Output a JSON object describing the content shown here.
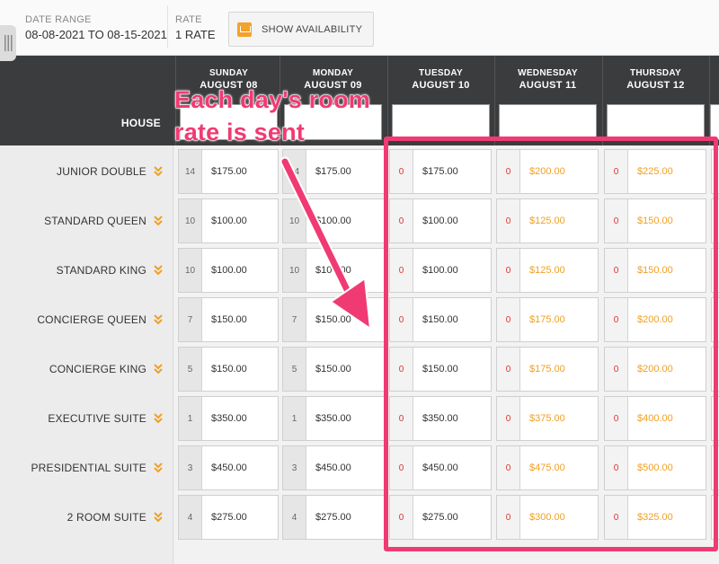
{
  "toolbar": {
    "date_range_label": "DATE RANGE",
    "date_range_value": "08-08-2021 TO 08-15-2021",
    "rate_label": "RATE",
    "rate_value": "1 RATE",
    "show_availability_label": "SHOW AVAILABILITY"
  },
  "grid": {
    "house_label": "HOUSE",
    "days": [
      {
        "name": "SUNDAY",
        "date": "AUGUST 08"
      },
      {
        "name": "MONDAY",
        "date": "AUGUST 09"
      },
      {
        "name": "TUESDAY",
        "date": "AUGUST 10"
      },
      {
        "name": "WEDNESDAY",
        "date": "AUGUST 11"
      },
      {
        "name": "THURSDAY",
        "date": "AUGUST 12"
      }
    ],
    "rooms": [
      {
        "name": "JUNIOR DOUBLE",
        "cells": [
          {
            "avail": "14",
            "price": "$175.00"
          },
          {
            "avail": "14",
            "price": "$175.00"
          },
          {
            "avail": "0",
            "price": "$175.00"
          },
          {
            "avail": "0",
            "price": "$200.00"
          },
          {
            "avail": "0",
            "price": "$225.00"
          }
        ]
      },
      {
        "name": "STANDARD QUEEN",
        "cells": [
          {
            "avail": "10",
            "price": "$100.00"
          },
          {
            "avail": "10",
            "price": "$100.00"
          },
          {
            "avail": "0",
            "price": "$100.00"
          },
          {
            "avail": "0",
            "price": "$125.00"
          },
          {
            "avail": "0",
            "price": "$150.00"
          }
        ]
      },
      {
        "name": "STANDARD KING",
        "cells": [
          {
            "avail": "10",
            "price": "$100.00"
          },
          {
            "avail": "10",
            "price": "$100.00"
          },
          {
            "avail": "0",
            "price": "$100.00"
          },
          {
            "avail": "0",
            "price": "$125.00"
          },
          {
            "avail": "0",
            "price": "$150.00"
          }
        ]
      },
      {
        "name": "CONCIERGE QUEEN",
        "cells": [
          {
            "avail": "7",
            "price": "$150.00"
          },
          {
            "avail": "7",
            "price": "$150.00"
          },
          {
            "avail": "0",
            "price": "$150.00"
          },
          {
            "avail": "0",
            "price": "$175.00"
          },
          {
            "avail": "0",
            "price": "$200.00"
          }
        ]
      },
      {
        "name": "CONCIERGE KING",
        "cells": [
          {
            "avail": "5",
            "price": "$150.00"
          },
          {
            "avail": "5",
            "price": "$150.00"
          },
          {
            "avail": "0",
            "price": "$150.00"
          },
          {
            "avail": "0",
            "price": "$175.00"
          },
          {
            "avail": "0",
            "price": "$200.00"
          }
        ]
      },
      {
        "name": "EXECUTIVE SUITE",
        "cells": [
          {
            "avail": "1",
            "price": "$350.00"
          },
          {
            "avail": "1",
            "price": "$350.00"
          },
          {
            "avail": "0",
            "price": "$350.00"
          },
          {
            "avail": "0",
            "price": "$375.00"
          },
          {
            "avail": "0",
            "price": "$400.00"
          }
        ]
      },
      {
        "name": "PRESIDENTIAL SUITE",
        "cells": [
          {
            "avail": "3",
            "price": "$450.00"
          },
          {
            "avail": "3",
            "price": "$450.00"
          },
          {
            "avail": "0",
            "price": "$450.00"
          },
          {
            "avail": "0",
            "price": "$475.00"
          },
          {
            "avail": "0",
            "price": "$500.00"
          }
        ]
      },
      {
        "name": "2 ROOM SUITE",
        "cells": [
          {
            "avail": "4",
            "price": "$275.00"
          },
          {
            "avail": "4",
            "price": "$275.00"
          },
          {
            "avail": "0",
            "price": "$275.00"
          },
          {
            "avail": "0",
            "price": "$300.00"
          },
          {
            "avail": "0",
            "price": "$325.00"
          }
        ]
      }
    ]
  },
  "annotation": {
    "line1": "Each day's room",
    "line2": "rate is sent"
  },
  "icons": {
    "availability": "calendar-icon",
    "expand": "double-chevron-down-icon",
    "rate_change": "star-icon",
    "drawer": "drawer-handle-icon"
  },
  "colors": {
    "header_bg": "#3b3c3e",
    "accent_orange": "#f0a023",
    "annotation_pink": "#f03a73",
    "zero_red": "#dd3333"
  }
}
